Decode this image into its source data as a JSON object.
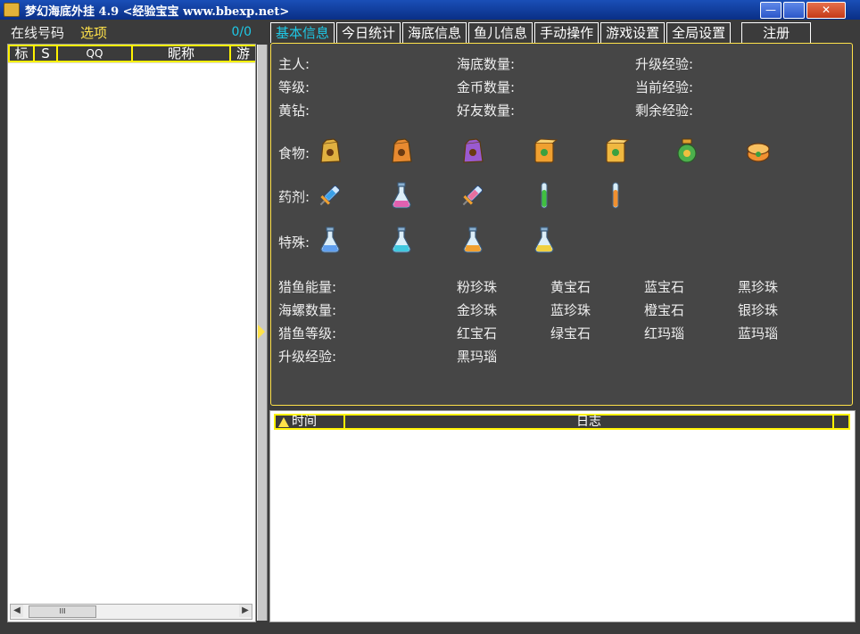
{
  "window": {
    "title": "梦幻海底外挂 4.9 <经验宝宝 www.bbexp.net>",
    "buttons": [
      "—",
      "",
      "✕"
    ]
  },
  "left": {
    "online_label": "在线号码",
    "options_label": "选项",
    "count": "0/0",
    "columns": [
      "标",
      "S",
      "QQ",
      "昵称",
      "游"
    ],
    "scroll_thumb": "III"
  },
  "tabs": [
    "基本信息",
    "今日统计",
    "海底信息",
    "鱼儿信息",
    "手动操作",
    "游戏设置",
    "全局设置",
    "注册"
  ],
  "info": {
    "row1": [
      "主人:",
      "海底数量:",
      "升级经验:"
    ],
    "row2": [
      "等级:",
      "金币数量:",
      "当前经验:"
    ],
    "row3": [
      "黄钻:",
      "好友数量:",
      "剩余经验:"
    ],
    "food_label": "食物:",
    "potion_label": "药剂:",
    "special_label": "特殊:",
    "hunt": [
      "猎鱼能量:",
      "海螺数量:",
      "猎鱼等级:",
      "升级经验:"
    ],
    "gems_col1": [
      "粉珍珠",
      "金珍珠",
      "红宝石",
      "黑玛瑙"
    ],
    "gems_col2": [
      "黄宝石",
      "蓝珍珠",
      "绿宝石"
    ],
    "gems_col3": [
      "蓝宝石",
      "橙宝石",
      "红玛瑙"
    ],
    "gems_col4": [
      "黑珍珠",
      "银珍珠",
      "蓝玛瑙"
    ]
  },
  "food_items": [
    {
      "icon": "tan-food-bag-icon",
      "color": "#e0b040"
    },
    {
      "icon": "orange-food-bag-icon",
      "color": "#e88a30"
    },
    {
      "icon": "purple-food-bag-icon",
      "color": "#9a5ad0"
    },
    {
      "icon": "orange-food-box-icon",
      "color": "#f0a030"
    },
    {
      "icon": "yellow-food-box-icon",
      "color": "#f0b840"
    },
    {
      "icon": "green-food-jar-icon",
      "color": "#4cb04c"
    },
    {
      "icon": "orange-food-can-icon",
      "color": "#f09030"
    }
  ],
  "potion_items": [
    {
      "icon": "blue-syringe-icon",
      "color": "#3aa0e8"
    },
    {
      "icon": "pink-flask-icon",
      "color": "#e060b0"
    },
    {
      "icon": "pink-syringe-icon",
      "color": "#e870a0"
    },
    {
      "icon": "green-test-tube-icon",
      "color": "#40c040"
    },
    {
      "icon": "orange-test-tube-icon",
      "color": "#f09030"
    }
  ],
  "special_items": [
    {
      "icon": "blue-special-flask-icon",
      "color": "#60a0f0"
    },
    {
      "icon": "cyan-special-flask-icon",
      "color": "#40c8e0"
    },
    {
      "icon": "orange-special-flask-icon",
      "color": "#f0a030"
    },
    {
      "icon": "yellow-special-flask-icon",
      "color": "#f0d040"
    }
  ],
  "log": {
    "time_col": "时间",
    "log_col": "日志"
  }
}
